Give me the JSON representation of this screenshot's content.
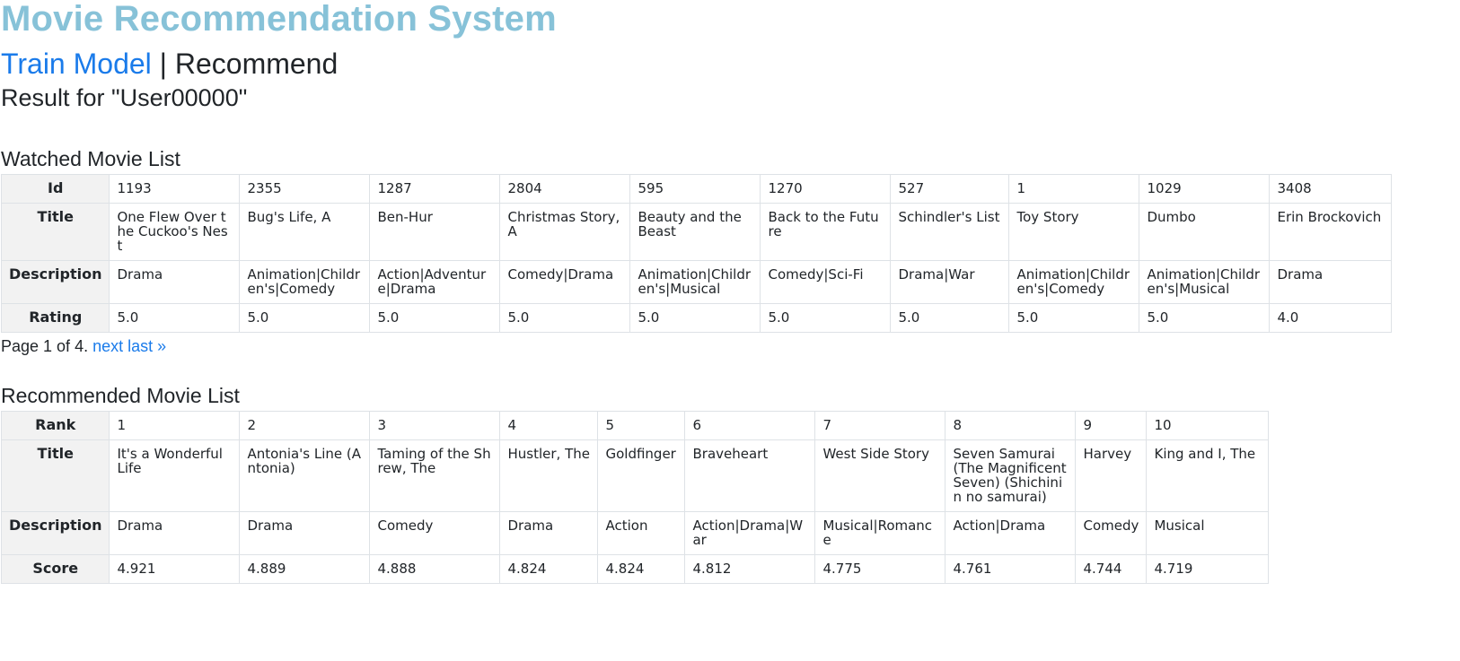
{
  "app_title": "Movie Recommendation System",
  "nav": {
    "train_label": "Train Model",
    "separator": "|",
    "recommend_label": "Recommend"
  },
  "result_title": "Result for \"User00000\"",
  "watched": {
    "title": "Watched Movie List",
    "row_headers": [
      "Id",
      "Title",
      "Description",
      "Rating"
    ],
    "movies": [
      {
        "id": "1193",
        "title": "One Flew Over the Cuckoo's Nest",
        "description": "Drama",
        "rating": "5.0"
      },
      {
        "id": "2355",
        "title": "Bug's Life, A",
        "description": "Animation|Children's|Comedy",
        "rating": "5.0"
      },
      {
        "id": "1287",
        "title": "Ben-Hur",
        "description": "Action|Adventure|Drama",
        "rating": "5.0"
      },
      {
        "id": "2804",
        "title": "Christmas Story, A",
        "description": "Comedy|Drama",
        "rating": "5.0"
      },
      {
        "id": "595",
        "title": "Beauty and the Beast",
        "description": "Animation|Children's|Musical",
        "rating": "5.0"
      },
      {
        "id": "1270",
        "title": "Back to the Future",
        "description": "Comedy|Sci-Fi",
        "rating": "5.0"
      },
      {
        "id": "527",
        "title": "Schindler's List",
        "description": "Drama|War",
        "rating": "5.0"
      },
      {
        "id": "1",
        "title": "Toy Story",
        "description": "Animation|Children's|Comedy",
        "rating": "5.0"
      },
      {
        "id": "1029",
        "title": "Dumbo",
        "description": "Animation|Children's|Musical",
        "rating": "5.0"
      },
      {
        "id": "3408",
        "title": "Erin Brockovich",
        "description": "Drama",
        "rating": "4.0"
      }
    ],
    "pager": {
      "text": "Page 1 of 4.",
      "next_label": "next",
      "last_label": "last »"
    }
  },
  "recommended": {
    "title": "Recommended Movie List",
    "row_headers": [
      "Rank",
      "Title",
      "Description",
      "Score"
    ],
    "movies": [
      {
        "rank": "1",
        "title": "It's a Wonderful Life",
        "description": "Drama",
        "score": "4.921"
      },
      {
        "rank": "2",
        "title": "Antonia's Line (Antonia)",
        "description": "Drama",
        "score": "4.889"
      },
      {
        "rank": "3",
        "title": "Taming of the Shrew, The",
        "description": "Comedy",
        "score": "4.888"
      },
      {
        "rank": "4",
        "title": "Hustler, The",
        "description": "Drama",
        "score": "4.824"
      },
      {
        "rank": "5",
        "title": "Goldfinger",
        "description": "Action",
        "score": "4.824"
      },
      {
        "rank": "6",
        "title": "Braveheart",
        "description": "Action|Drama|War",
        "score": "4.812"
      },
      {
        "rank": "7",
        "title": "West Side Story",
        "description": "Musical|Romance",
        "score": "4.775"
      },
      {
        "rank": "8",
        "title": "Seven Samurai (The Magnificent Seven) (Shichinin no samurai)",
        "description": "Action|Drama",
        "score": "4.761"
      },
      {
        "rank": "9",
        "title": "Harvey",
        "description": "Comedy",
        "score": "4.744"
      },
      {
        "rank": "10",
        "title": "King and I, The",
        "description": "Musical",
        "score": "4.719"
      }
    ]
  }
}
